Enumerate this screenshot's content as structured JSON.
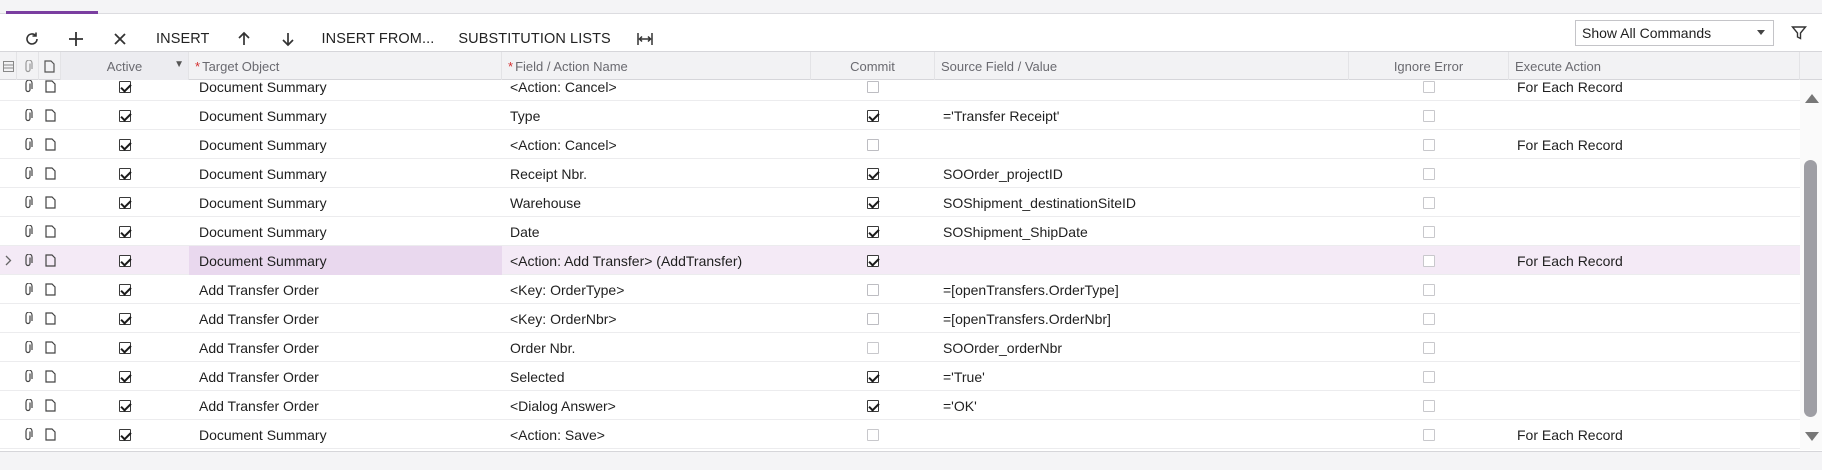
{
  "toolbar": {
    "insert_label": "INSERT",
    "insert_from_label": "INSERT FROM...",
    "substitution_lists_label": "SUBSTITUTION LISTS",
    "command_filter_value": "Show All Commands"
  },
  "columns": {
    "active": "Active",
    "target_object": "Target Object",
    "field_action": "Field / Action Name",
    "commit": "Commit",
    "source_field": "Source Field / Value",
    "ignore_error": "Ignore Error",
    "execute_action": "Execute Action"
  },
  "rows": [
    {
      "active": true,
      "target": "Document Summary",
      "field": "<Action: Cancel>",
      "commit": false,
      "commit_disabled": true,
      "source": "",
      "ignore_error": false,
      "execute": "For Each Record"
    },
    {
      "active": true,
      "target": "Document Summary",
      "field": "Type",
      "commit": true,
      "commit_disabled": false,
      "source": "='Transfer Receipt'",
      "ignore_error": false,
      "execute": ""
    },
    {
      "active": true,
      "target": "Document Summary",
      "field": "<Action: Cancel>",
      "commit": false,
      "commit_disabled": true,
      "source": "",
      "ignore_error": false,
      "execute": "For Each Record"
    },
    {
      "active": true,
      "target": "Document Summary",
      "field": "Receipt Nbr.",
      "commit": true,
      "commit_disabled": false,
      "source": "SOOrder_projectID",
      "ignore_error": false,
      "execute": ""
    },
    {
      "active": true,
      "target": "Document Summary",
      "field": "Warehouse",
      "commit": true,
      "commit_disabled": false,
      "source": "SOShipment_destinationSiteID",
      "ignore_error": false,
      "execute": ""
    },
    {
      "active": true,
      "target": "Document Summary",
      "field": "Date",
      "commit": true,
      "commit_disabled": false,
      "source": "SOShipment_ShipDate",
      "ignore_error": false,
      "execute": ""
    },
    {
      "active": true,
      "target": "Document Summary",
      "field": "<Action: Add Transfer> (AddTransfer)",
      "commit": true,
      "commit_disabled": false,
      "source": "",
      "ignore_error": false,
      "execute": "For Each Record",
      "selected": true
    },
    {
      "active": true,
      "target": "Add Transfer Order",
      "field": "<Key: OrderType>",
      "commit": false,
      "commit_disabled": true,
      "source": "=[openTransfers.OrderType]",
      "ignore_error": false,
      "execute": ""
    },
    {
      "active": true,
      "target": "Add Transfer Order",
      "field": "<Key: OrderNbr>",
      "commit": false,
      "commit_disabled": true,
      "source": "=[openTransfers.OrderNbr]",
      "ignore_error": false,
      "execute": ""
    },
    {
      "active": true,
      "target": "Add Transfer Order",
      "field": "Order Nbr.",
      "commit": false,
      "commit_disabled": false,
      "source": "SOOrder_orderNbr",
      "ignore_error": false,
      "execute": ""
    },
    {
      "active": true,
      "target": "Add Transfer Order",
      "field": "Selected",
      "commit": true,
      "commit_disabled": false,
      "source": "='True'",
      "ignore_error": false,
      "execute": ""
    },
    {
      "active": true,
      "target": "Add Transfer Order",
      "field": "<Dialog Answer>",
      "commit": true,
      "commit_disabled": false,
      "source": "='OK'",
      "ignore_error": false,
      "execute": ""
    },
    {
      "active": true,
      "target": "Document Summary",
      "field": "<Action: Save>",
      "commit": false,
      "commit_disabled": false,
      "source": "",
      "ignore_error": false,
      "execute": "For Each Record"
    }
  ],
  "icons": {
    "refresh": "refresh-icon",
    "add": "plus-icon",
    "delete": "close-icon",
    "move_up": "arrow-up-icon",
    "move_down": "arrow-down-icon",
    "fit_columns": "fit-columns-icon",
    "filter": "filter-icon",
    "attach": "paperclip-icon",
    "note": "note-icon"
  },
  "colors": {
    "accent": "#7a3ea0",
    "selected_row": "#f4eaf6",
    "selected_cell": "#e9d8ee",
    "required": "#d32f2f"
  }
}
